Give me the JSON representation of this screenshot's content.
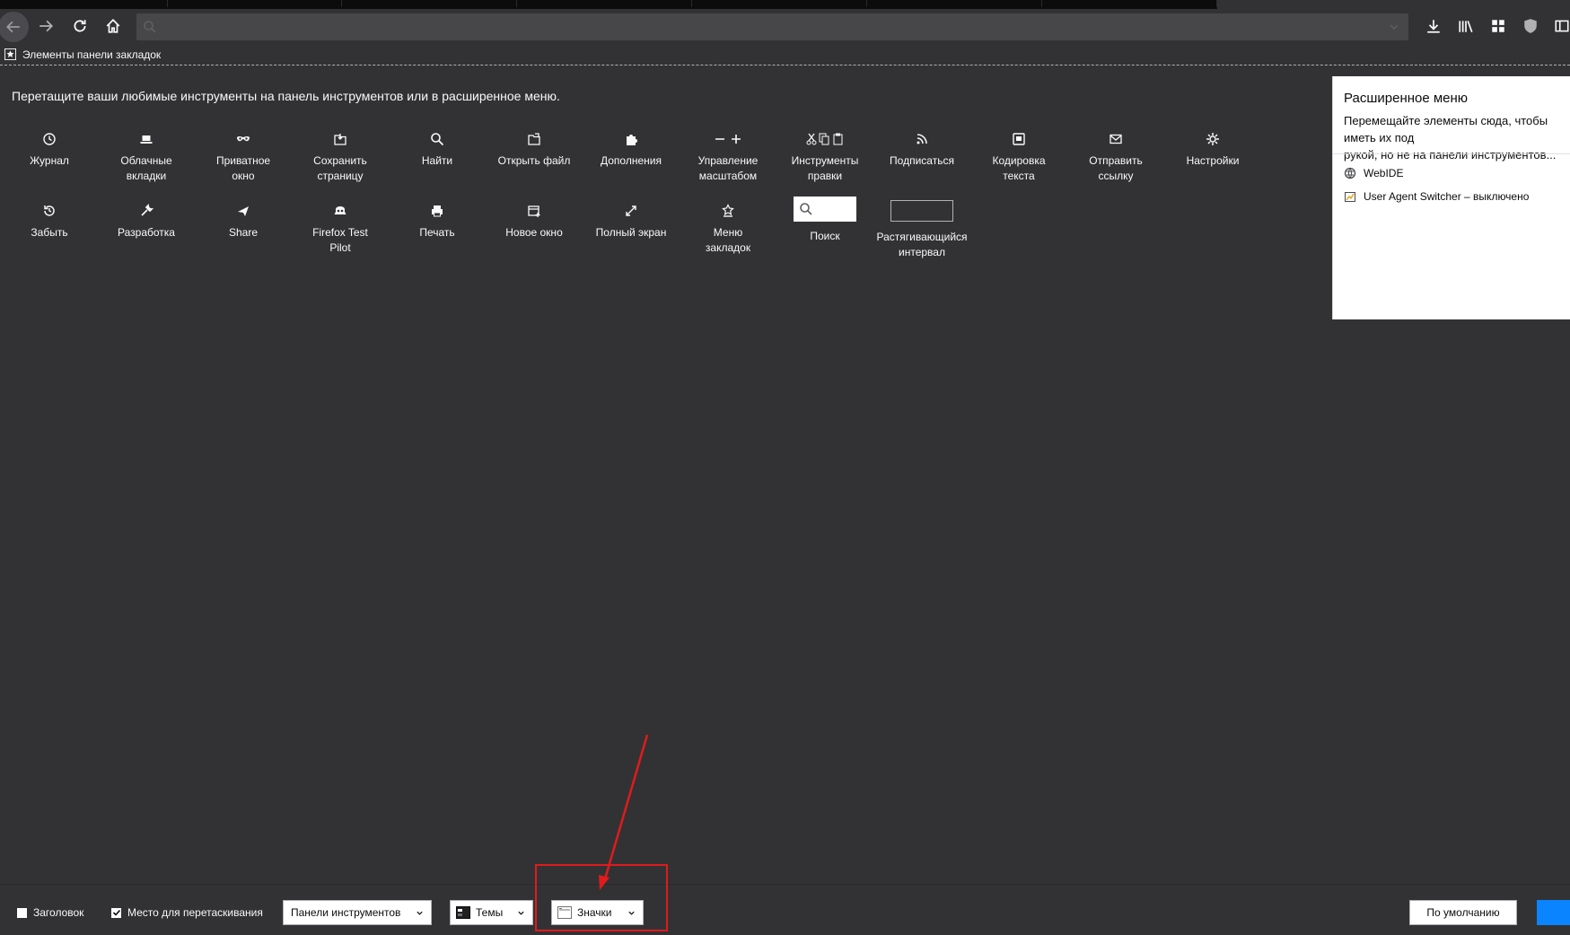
{
  "bookmarks_toolbar": {
    "label": "Элементы панели закладок"
  },
  "customize": {
    "instruction": "Перетащите ваши любимые инструменты на панель инструментов или в расширенное меню.",
    "items": [
      {
        "label": "Журнал",
        "icon": "history-icon"
      },
      {
        "label": "Облачные\nвкладки",
        "icon": "synced-tabs-icon"
      },
      {
        "label": "Приватное\nокно",
        "icon": "private-window-icon"
      },
      {
        "label": "Сохранить\nстраницу",
        "icon": "save-page-icon"
      },
      {
        "label": "Найти",
        "icon": "find-icon"
      },
      {
        "label": "Открыть файл",
        "icon": "open-file-icon"
      },
      {
        "label": "Дополнения",
        "icon": "addons-icon"
      },
      {
        "label": "Управление\nмасштабом",
        "icon": "zoom-controls-icon"
      },
      {
        "label": "Инструменты\nправки",
        "icon": "edit-controls-icon"
      },
      {
        "label": "Подписаться",
        "icon": "feed-icon"
      },
      {
        "label": "Кодировка\nтекста",
        "icon": "text-encoding-icon"
      },
      {
        "label": "Отправить\nссылку",
        "icon": "email-link-icon"
      },
      {
        "label": "Настройки",
        "icon": "preferences-icon"
      },
      {
        "label": "Забыть",
        "icon": "forget-icon"
      },
      {
        "label": "Разработка",
        "icon": "developer-icon"
      },
      {
        "label": "Share",
        "icon": "share-icon"
      },
      {
        "label": "Firefox Test\nPilot",
        "icon": "test-pilot-icon"
      },
      {
        "label": "Печать",
        "icon": "print-icon"
      },
      {
        "label": "Новое окно",
        "icon": "new-window-icon"
      },
      {
        "label": "Полный экран",
        "icon": "fullscreen-icon"
      },
      {
        "label": "Меню\nзакладок",
        "icon": "bookmarks-menu-icon"
      },
      {
        "label": "Поиск",
        "icon": "search-widget"
      },
      {
        "label": "Растягивающийся\nинтервал",
        "icon": "flexible-space"
      }
    ]
  },
  "overflow": {
    "title": "Расширенное меню",
    "description": "Перемещайте элементы сюда, чтобы иметь их под\nрукой, но не на панели инструментов...",
    "items": [
      {
        "label": "WebIDE",
        "icon": "webide-icon"
      },
      {
        "label": "User Agent Switcher – выключено",
        "icon": "user-agent-switcher-icon"
      }
    ]
  },
  "footer": {
    "title_bar": {
      "label": "Заголовок",
      "checked": false
    },
    "drag_space": {
      "label": "Место для перетаскивания",
      "checked": true
    },
    "toolbars_dropdown": "Панели инструментов",
    "themes_dropdown": "Темы",
    "density_dropdown": "Значки",
    "reset_button": "По умолчанию"
  },
  "colors": {
    "background": "#323234",
    "accent": "#0a84ff",
    "annotation": "#e01b1b"
  }
}
